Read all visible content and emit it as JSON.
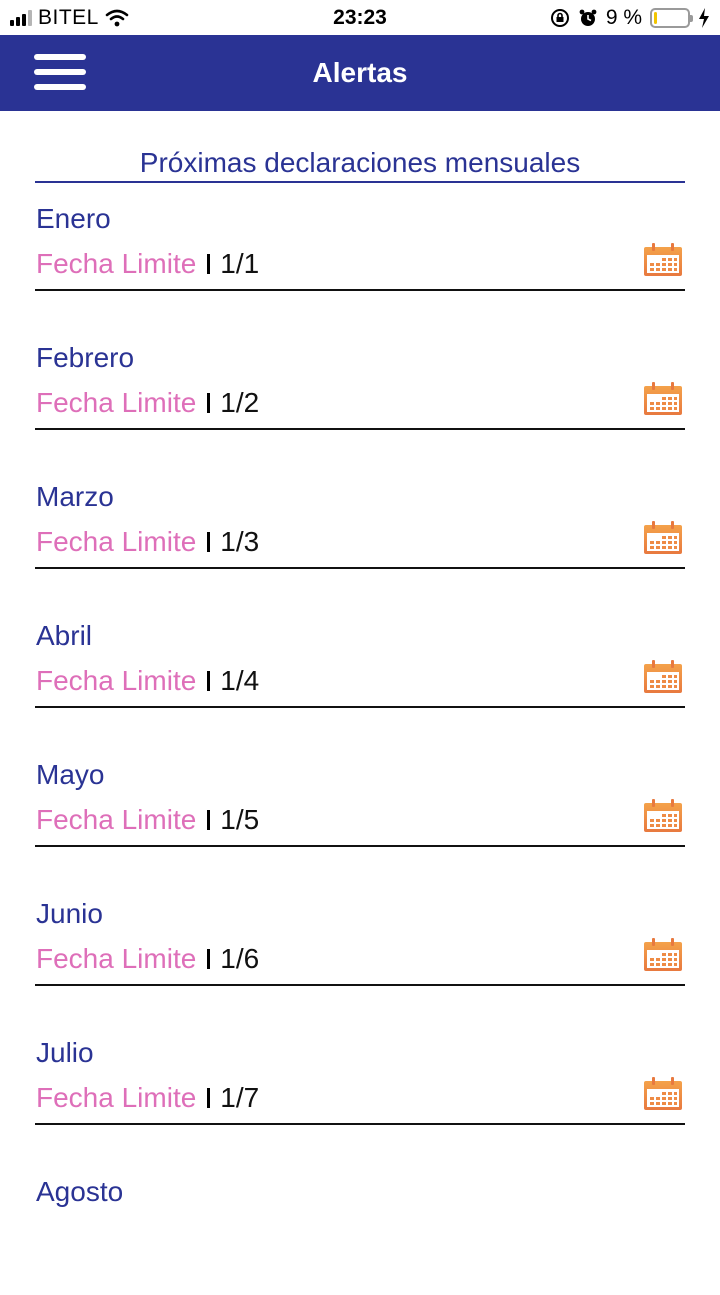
{
  "status_bar": {
    "carrier": "BITEL",
    "time": "23:23",
    "battery_text": "9 %",
    "battery_level": 0.09,
    "icons": [
      "signal-icon",
      "wifi-icon",
      "orientation-lock-icon",
      "alarm-icon",
      "battery-icon",
      "charging-bolt-icon"
    ]
  },
  "header": {
    "title": "Alertas",
    "menu_icon": "hamburger-menu-icon",
    "background": "#2a3394"
  },
  "section": {
    "title": "Próximas declaraciones mensuales"
  },
  "colors": {
    "primary": "#2a3394",
    "label_pink": "#de6fb9",
    "calendar_orange": "#f0944f"
  },
  "months": [
    {
      "name": "Enero",
      "label": "Fecha Limite",
      "date": "1/1"
    },
    {
      "name": "Febrero",
      "label": "Fecha Limite",
      "date": "1/2"
    },
    {
      "name": "Marzo",
      "label": "Fecha Limite",
      "date": "1/3"
    },
    {
      "name": "Abril",
      "label": "Fecha Limite",
      "date": "1/4"
    },
    {
      "name": "Mayo",
      "label": "Fecha Limite",
      "date": "1/5"
    },
    {
      "name": "Junio",
      "label": "Fecha Limite",
      "date": "1/6"
    },
    {
      "name": "Julio",
      "label": "Fecha Limite",
      "date": "1/7"
    },
    {
      "name": "Agosto"
    }
  ]
}
